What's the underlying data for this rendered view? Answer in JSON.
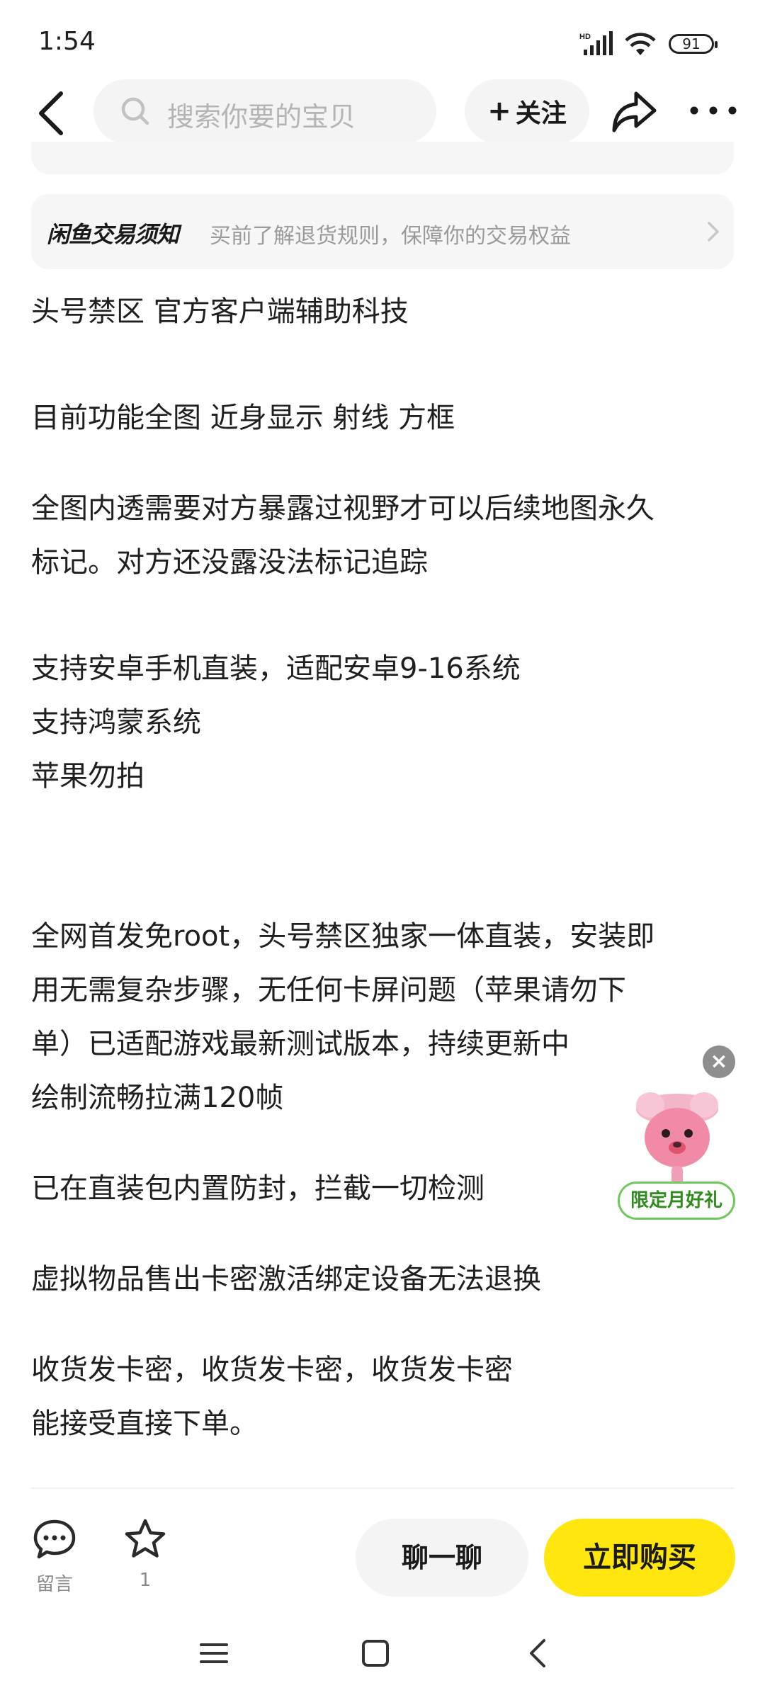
{
  "status_bar": {
    "time": "1:54",
    "network_label": "HD",
    "battery": "91"
  },
  "top_nav": {
    "search_placeholder": "搜索你要的宝贝",
    "follow_label": "关注",
    "follow_plus": "+"
  },
  "trade_notice": {
    "brand": "闲鱼交易须知",
    "text": "买前了解退货规则，保障你的交易权益"
  },
  "description": {
    "lines": [
      "头号禁区  官方客户端辅助科技",
      "目前功能全图  近身显示 射线 方框",
      "全图内透需要对方暴露过视野才可以后续地图永久",
      "标记。对方还没露没法标记追踪",
      "支持安卓手机直装，适配安卓9-16系统",
      "支持鸿蒙系统",
      "苹果勿拍",
      "全网首发免root，头号禁区独家一体直装，安装即",
      "用无需复杂步骤，无任何卡屏问题（苹果请勿下",
      "单）已适配游戏最新测试版本，持续更新中",
      "绘制流畅拉满120帧",
      "已在直装包内置防封，拦截一切检测",
      "虚拟物品售出卡密激活绑定设备无法退换",
      "收货发卡密，收货发卡密，收货发卡密",
      "能接受直接下单。"
    ]
  },
  "promo": {
    "label": "限定月好礼",
    "close": "×"
  },
  "bottom_bar": {
    "comment_label": "留言",
    "favorite_count": "1",
    "chat_label": "聊一聊",
    "buy_label": "立即购买"
  },
  "colors": {
    "buy_button": "#ffe60f",
    "pill_background": "#f4f4f4",
    "promo_green": "#2e8b1c"
  }
}
